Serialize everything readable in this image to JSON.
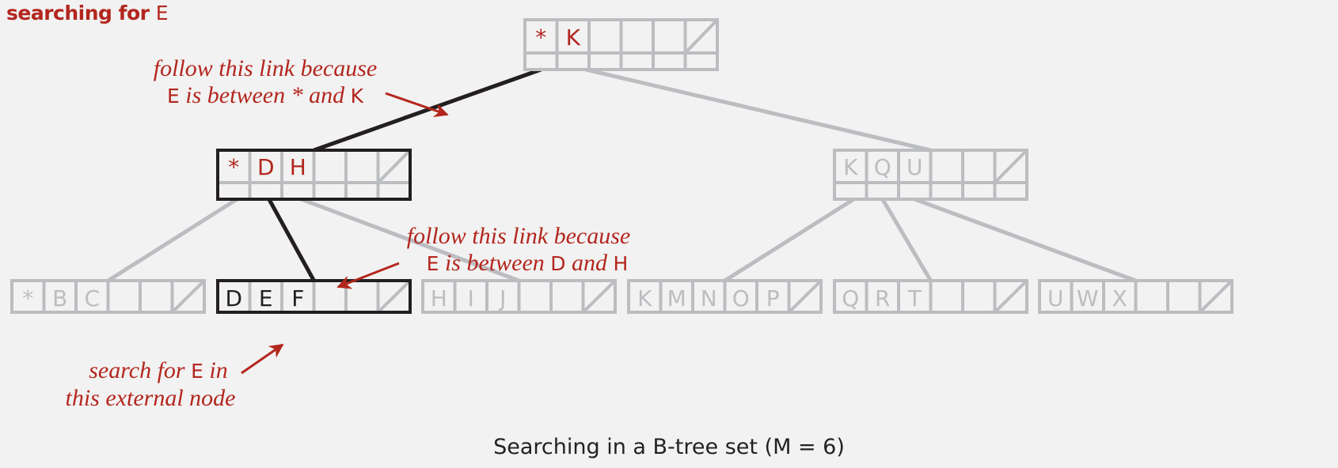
{
  "heading": {
    "prefix": "searching for",
    "key": "E"
  },
  "caption": "Searching in a B-tree set (M = 6)",
  "colors": {
    "highlight": "#b3261e",
    "active": "#231f20",
    "inactive": "#bcbdc0",
    "background": "#f2f2f2"
  },
  "annotations": [
    {
      "id": "root-link",
      "line1": "follow this link because",
      "line2_key": "E",
      "line2_text": " is between * and ",
      "line2_end": "K"
    },
    {
      "id": "internal-link",
      "line1": "follow this link because",
      "line2_key": "E",
      "line2_text": " is between ",
      "line2_mid": "D",
      "line2_text2": " and ",
      "line2_end": "H"
    },
    {
      "id": "external-node",
      "line1_text": "search for ",
      "line1_key": "E",
      "line1_end": " in",
      "line2": "this external node"
    }
  ],
  "tree": {
    "order_M": 6,
    "root": {
      "keys": [
        "*",
        "K"
      ],
      "state": "visited"
    },
    "internal": [
      {
        "keys": [
          "*",
          "D",
          "H"
        ],
        "state": "active"
      },
      {
        "keys": [
          "K",
          "Q",
          "U"
        ],
        "state": "inactive"
      }
    ],
    "external": [
      {
        "keys": [
          "*",
          "B",
          "C"
        ],
        "state": "inactive"
      },
      {
        "keys": [
          "D",
          "E",
          "F"
        ],
        "state": "active"
      },
      {
        "keys": [
          "H",
          "I",
          "J"
        ],
        "state": "inactive"
      },
      {
        "keys": [
          "K",
          "M",
          "N",
          "O",
          "P"
        ],
        "state": "inactive"
      },
      {
        "keys": [
          "Q",
          "R",
          "T"
        ],
        "state": "inactive"
      },
      {
        "keys": [
          "U",
          "W",
          "X"
        ],
        "state": "inactive"
      }
    ]
  }
}
